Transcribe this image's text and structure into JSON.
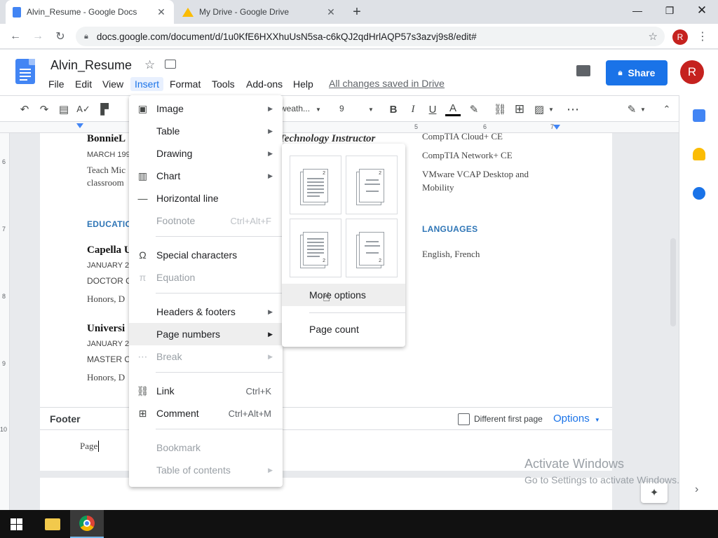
{
  "browser": {
    "tabs": [
      {
        "title": "Alvin_Resume - Google Docs",
        "icon": "docs-icon",
        "active": true
      },
      {
        "title": "My Drive - Google Drive",
        "icon": "drive-icon",
        "active": false
      }
    ],
    "url": "docs.google.com/document/d/1u0KfE6HXXhuUsN5sa-c6kQJ2qdHrlAQP57s3azvj9s8/edit#",
    "profile_initial": "R"
  },
  "docs": {
    "title": "Alvin_Resume",
    "menus": [
      "File",
      "Edit",
      "View",
      "Insert",
      "Format",
      "Tools",
      "Add-ons",
      "Help"
    ],
    "saved_status": "All changes saved in Drive",
    "share_label": "Share",
    "avatar_initial": "R"
  },
  "toolbar": {
    "font": "weath...",
    "font_size": "9"
  },
  "ruler": {
    "h_marks": [
      "5",
      "6",
      "7"
    ],
    "v_marks": [
      "6",
      "7",
      "8",
      "9",
      "10"
    ]
  },
  "document": {
    "left": {
      "name": "BonnieL",
      "date1": "MARCH 199",
      "desc1": "Teach Mic",
      "desc2": "classroom",
      "education_head": "EDUCATIO",
      "school1": "Capella U",
      "school1_date": "JANUARY 20",
      "school1_degree": "DOCTOR O",
      "school1_honors": "Honors, D",
      "school2": "Universi",
      "school2_date": "JANUARY 20",
      "school2_degree": "MASTER O",
      "school2_honors": "Honors, D"
    },
    "middle": {
      "job_title": "Technology Instructor"
    },
    "right": {
      "cert1": "CompTIA Cloud+ CE",
      "cert2": "CompTIA Network+ CE",
      "cert3a": "VMware VCAP Desktop and",
      "cert3b": "Mobility",
      "languages_head": "LANGUAGES",
      "languages": "English, French"
    },
    "footer": {
      "label": "Footer",
      "different_first_page": "Different first page",
      "options": "Options",
      "text": "Page"
    }
  },
  "insert_menu": {
    "items": [
      {
        "label": "Image",
        "icon": "image-icon",
        "submenu": true
      },
      {
        "label": "Table",
        "submenu": true
      },
      {
        "label": "Drawing",
        "submenu": true
      },
      {
        "label": "Chart",
        "icon": "chart-icon",
        "submenu": true
      },
      {
        "label": "Horizontal line",
        "icon": "horizontal-line-icon"
      },
      {
        "label": "Footnote",
        "shortcut": "Ctrl+Alt+F",
        "disabled": true
      },
      {
        "label": "Special characters",
        "icon": "omega-icon"
      },
      {
        "label": "Equation",
        "icon": "pi-icon",
        "disabled": true
      },
      {
        "label": "Headers & footers",
        "submenu": true
      },
      {
        "label": "Page numbers",
        "submenu": true,
        "highlighted": true
      },
      {
        "label": "Break",
        "icon": "break-icon",
        "submenu": true,
        "disabled": true
      },
      {
        "label": "Link",
        "icon": "link-icon",
        "shortcut": "Ctrl+K"
      },
      {
        "label": "Comment",
        "icon": "comment-add-icon",
        "shortcut": "Ctrl+Alt+M"
      },
      {
        "label": "Bookmark",
        "disabled": true
      },
      {
        "label": "Table of contents",
        "submenu": true,
        "disabled": true
      }
    ]
  },
  "page_numbers_menu": {
    "thumbs": [
      {
        "number": "2",
        "position": "top-right, all pages"
      },
      {
        "number": "2",
        "position": "top-right, skip first"
      },
      {
        "number": "2",
        "position": "bottom-right, all pages"
      },
      {
        "number": "2",
        "position": "bottom-right, skip first"
      }
    ],
    "more_options": "More options",
    "page_count": "Page count"
  },
  "watermark": {
    "line1": "Activate Windows",
    "line2": "Go to Settings to activate Windows."
  },
  "colors": {
    "accent": "#1a73e8",
    "docs_blue": "#4285f4",
    "heading_blue": "#2e75b6",
    "avatar_red": "#c5221f"
  }
}
